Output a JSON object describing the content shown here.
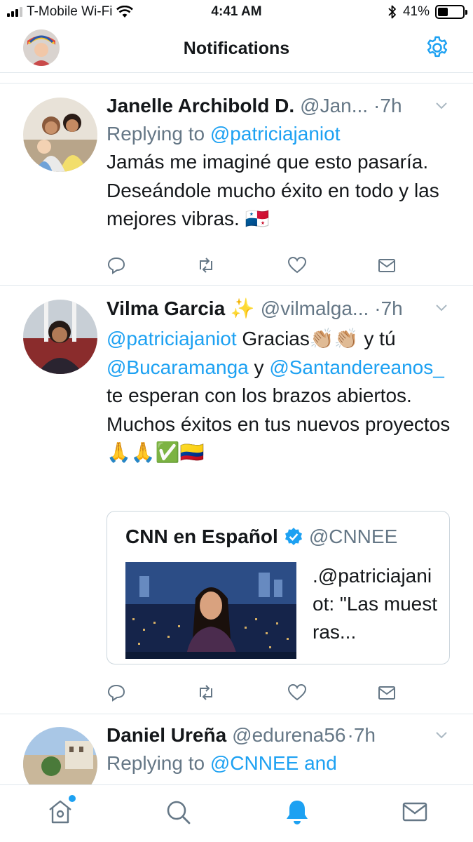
{
  "status_bar": {
    "carrier": "T-Mobile Wi-Fi",
    "time": "4:41 AM",
    "battery": "41%",
    "battery_level": 0.41
  },
  "header": {
    "title": "Notifications",
    "settings_icon": "gear-icon"
  },
  "colors": {
    "accent": "#1da1f2",
    "secondary_text": "#657786",
    "divider": "#e1e8ed"
  },
  "tweets": [
    {
      "name": "Janelle Archibold D.",
      "handle": "@Jan...",
      "time": "·7h",
      "reply_prefix": "Replying to ",
      "reply_to": "@patriciajaniot",
      "text": "Jamás me imaginé que esto pasaría. Deseándole mucho éxito en todo y las mejores vibras. 🇵🇦"
    },
    {
      "name": "Vilma Garcia ✨",
      "handle": "@vilmalga...",
      "time": "·7h",
      "mention1": "@patriciajaniot",
      "text1": " Gracias👏🏼👏🏼 y tú ",
      "mention2": "@Bucaramanga",
      "text2": " y ",
      "mention3": "@Santandereanos_",
      "text3": " te esperan con los brazos abiertos. Muchos éxitos en tus nuevos proyectos 🙏🙏✅🇨🇴",
      "quote": {
        "name": "CNN en Español",
        "handle": "@CNNEE",
        "text": ".@patriciajaniot: \"Las muestras..."
      }
    },
    {
      "name": "Daniel Ureña",
      "handle": "@edurena56",
      "time": "·7h",
      "reply_prefix": "Replying to ",
      "reply_to": "@CNNEE and"
    }
  ],
  "tabbar": {
    "items": [
      "home-icon",
      "search-icon",
      "bell-icon",
      "mail-icon"
    ],
    "active": "bell-icon"
  }
}
